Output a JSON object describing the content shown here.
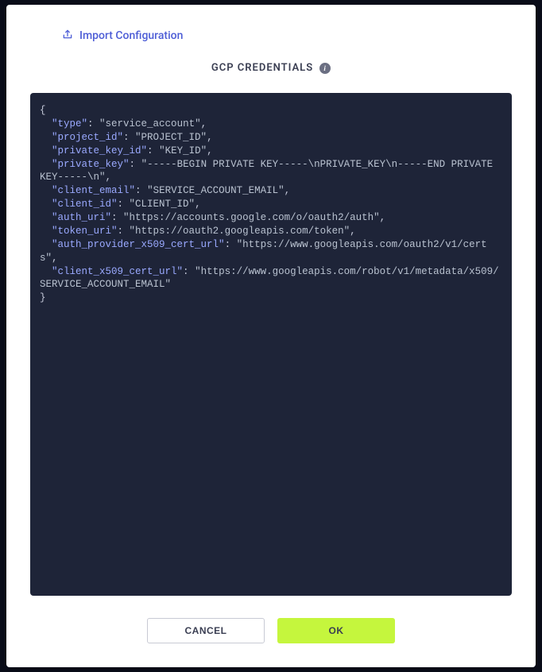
{
  "import_link": {
    "label": "Import Configuration"
  },
  "section": {
    "title": "GCP CREDENTIALS"
  },
  "credentials": {
    "type": "service_account",
    "project_id": "PROJECT_ID",
    "private_key_id": "KEY_ID",
    "private_key": "-----BEGIN PRIVATE KEY-----\\nPRIVATE_KEY\\n-----END PRIVATE KEY-----\\n",
    "client_email": "SERVICE_ACCOUNT_EMAIL",
    "client_id": "CLIENT_ID",
    "auth_uri": "https://accounts.google.com/o/oauth2/auth",
    "token_uri": "https://oauth2.googleapis.com/token",
    "auth_provider_x509_cert_url": "https://www.googleapis.com/oauth2/v1/certs",
    "client_x509_cert_url": "https://www.googleapis.com/robot/v1/metadata/x509/SERVICE_ACCOUNT_EMAIL"
  },
  "actions": {
    "cancel_label": "CANCEL",
    "ok_label": "OK"
  }
}
